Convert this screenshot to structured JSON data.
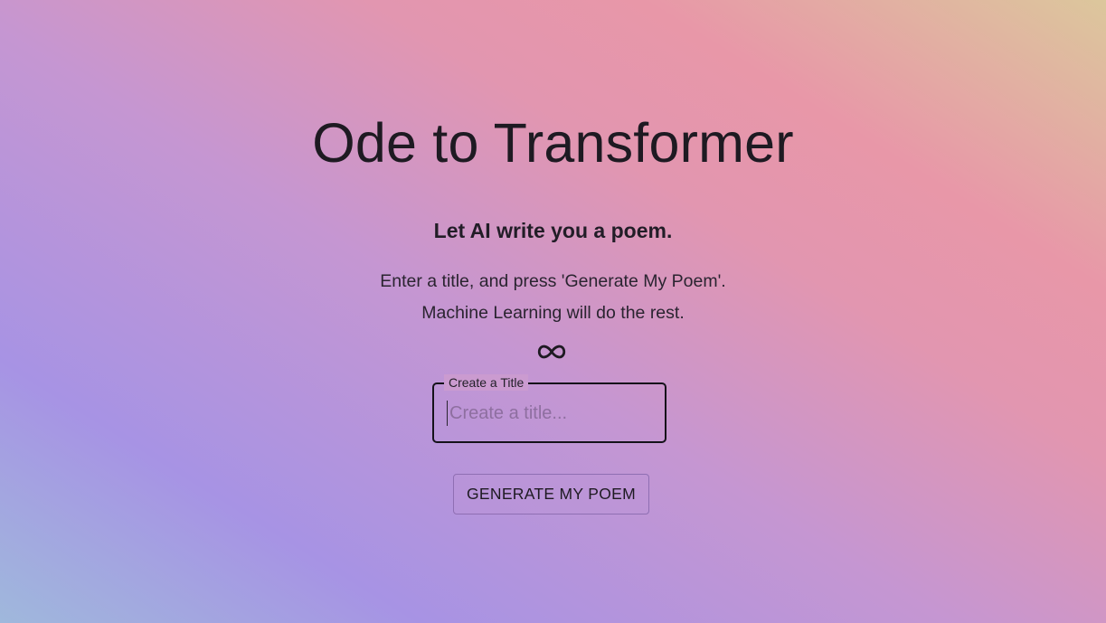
{
  "header": {
    "title": "Ode to Transformer",
    "subtitle": "Let AI write you a poem."
  },
  "description": {
    "line1": "Enter a title, and press 'Generate My Poem'.",
    "line2": "Machine Learning will do the rest."
  },
  "decoration": {
    "icon": "infinity-icon"
  },
  "title_field": {
    "label": "Create a Title",
    "placeholder": "Create a title...",
    "value": ""
  },
  "actions": {
    "generate_label": "GENERATE MY POEM"
  },
  "colors": {
    "text": "#1e1a22",
    "field_border": "#15121a",
    "button_border": "#8f6fb3",
    "gradient_start": "#9fb8dc",
    "gradient_mid": "#a793e4",
    "gradient_pink": "#e897a8",
    "gradient_end": "#dcc79c"
  }
}
